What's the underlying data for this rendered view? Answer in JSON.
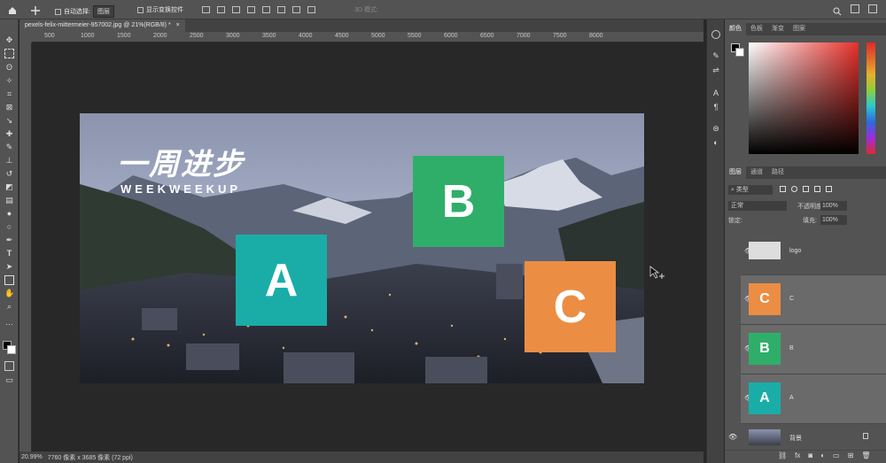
{
  "options_bar": {
    "auto_select_label": "自动选择:",
    "auto_select_value": "图层",
    "show_transform_label": "显示变换控件",
    "mode_3d_label": "3D 模式:"
  },
  "document": {
    "tab_title": "pexels-felix-mittermeier-957002.jpg @ 21%(RGB/8) *",
    "close_glyph": "×",
    "zoom": "20.99%",
    "size_info": "7760 像素 x 3685 像素 (72 ppi)"
  },
  "ruler": {
    "top_ticks": [
      "500",
      "1000",
      "1500",
      "2000",
      "2500",
      "3000",
      "3500",
      "4000",
      "4500",
      "5000",
      "5500",
      "6000",
      "6500",
      "7000",
      "7500",
      "8000"
    ]
  },
  "artwork": {
    "title_text": "一周进步",
    "subtitle_text": "WEEKWEEKUP",
    "box_a": "A",
    "box_b": "B",
    "box_c": "C"
  },
  "colors": {
    "box_a": "#1aada8",
    "box_b": "#2fae6a",
    "box_c": "#ec8d44",
    "panel_bg": "#535353",
    "app_bg": "#282828"
  },
  "color_panel": {
    "tabs": [
      "颜色",
      "色板",
      "渐变",
      "图案"
    ]
  },
  "layers_panel": {
    "tabs": [
      "图层",
      "通道",
      "路径"
    ],
    "filter_label": "类型",
    "blend_mode": "正常",
    "opacity_label": "不透明度:",
    "opacity_value": "100%",
    "lock_label": "锁定:",
    "fill_label": "填充:",
    "fill_value": "100%",
    "layers": [
      {
        "name": "logo"
      },
      {
        "name": "C",
        "thumb": "C"
      },
      {
        "name": "B",
        "thumb": "B"
      },
      {
        "name": "A",
        "thumb": "A"
      },
      {
        "name": "背景"
      }
    ],
    "footer_icons": [
      "link-icon",
      "fx-icon",
      "mask-icon",
      "adjustment-icon",
      "group-icon",
      "new-layer-icon",
      "trash-icon"
    ]
  }
}
